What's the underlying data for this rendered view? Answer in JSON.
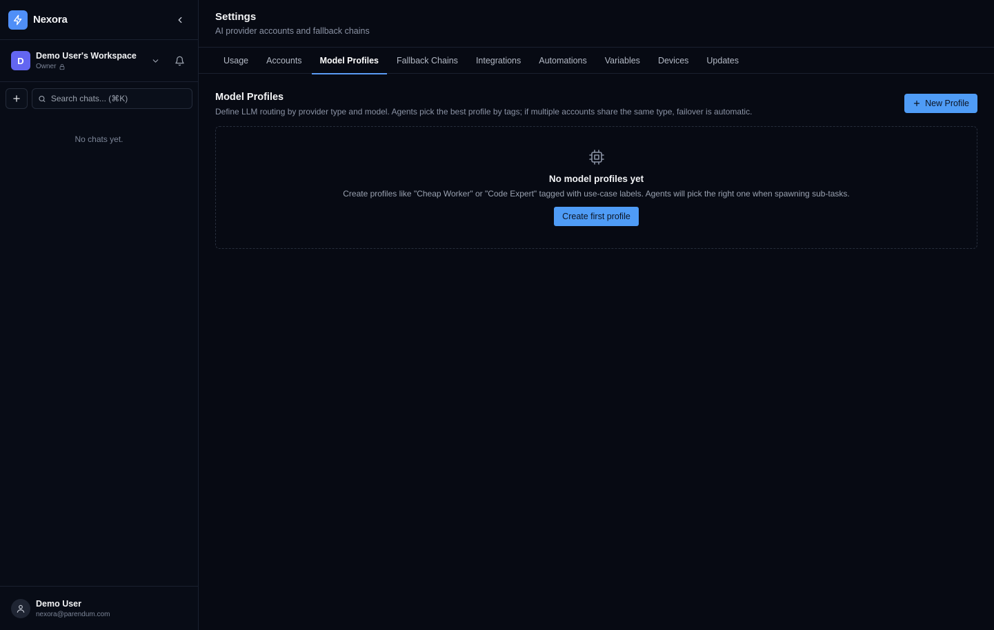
{
  "app": {
    "name": "Nexora",
    "accent": "#4f9cf6"
  },
  "workspace": {
    "initial": "D",
    "name": "Demo User's Workspace",
    "role": "Owner"
  },
  "search": {
    "placeholder": "Search chats... (⌘K)"
  },
  "chats": {
    "empty_text": "No chats yet."
  },
  "user": {
    "name": "Demo User",
    "email": "nexora@parendum.com"
  },
  "header": {
    "title": "Settings",
    "subtitle": "AI provider accounts and fallback chains"
  },
  "tabs": [
    {
      "label": "Usage"
    },
    {
      "label": "Accounts"
    },
    {
      "label": "Model Profiles"
    },
    {
      "label": "Fallback Chains"
    },
    {
      "label": "Integrations"
    },
    {
      "label": "Automations"
    },
    {
      "label": "Variables"
    },
    {
      "label": "Devices"
    },
    {
      "label": "Updates"
    }
  ],
  "section": {
    "title": "Model Profiles",
    "description": "Define LLM routing by provider type and model. Agents pick the best profile by tags; if multiple accounts share the same type, failover is automatic.",
    "new_button": "New Profile"
  },
  "empty_state": {
    "icon": "cpu-icon",
    "title": "No model profiles yet",
    "description": "Create profiles like \"Cheap Worker\" or \"Code Expert\" tagged with use-case labels. Agents will pick the right one when spawning sub-tasks.",
    "button": "Create first profile"
  }
}
